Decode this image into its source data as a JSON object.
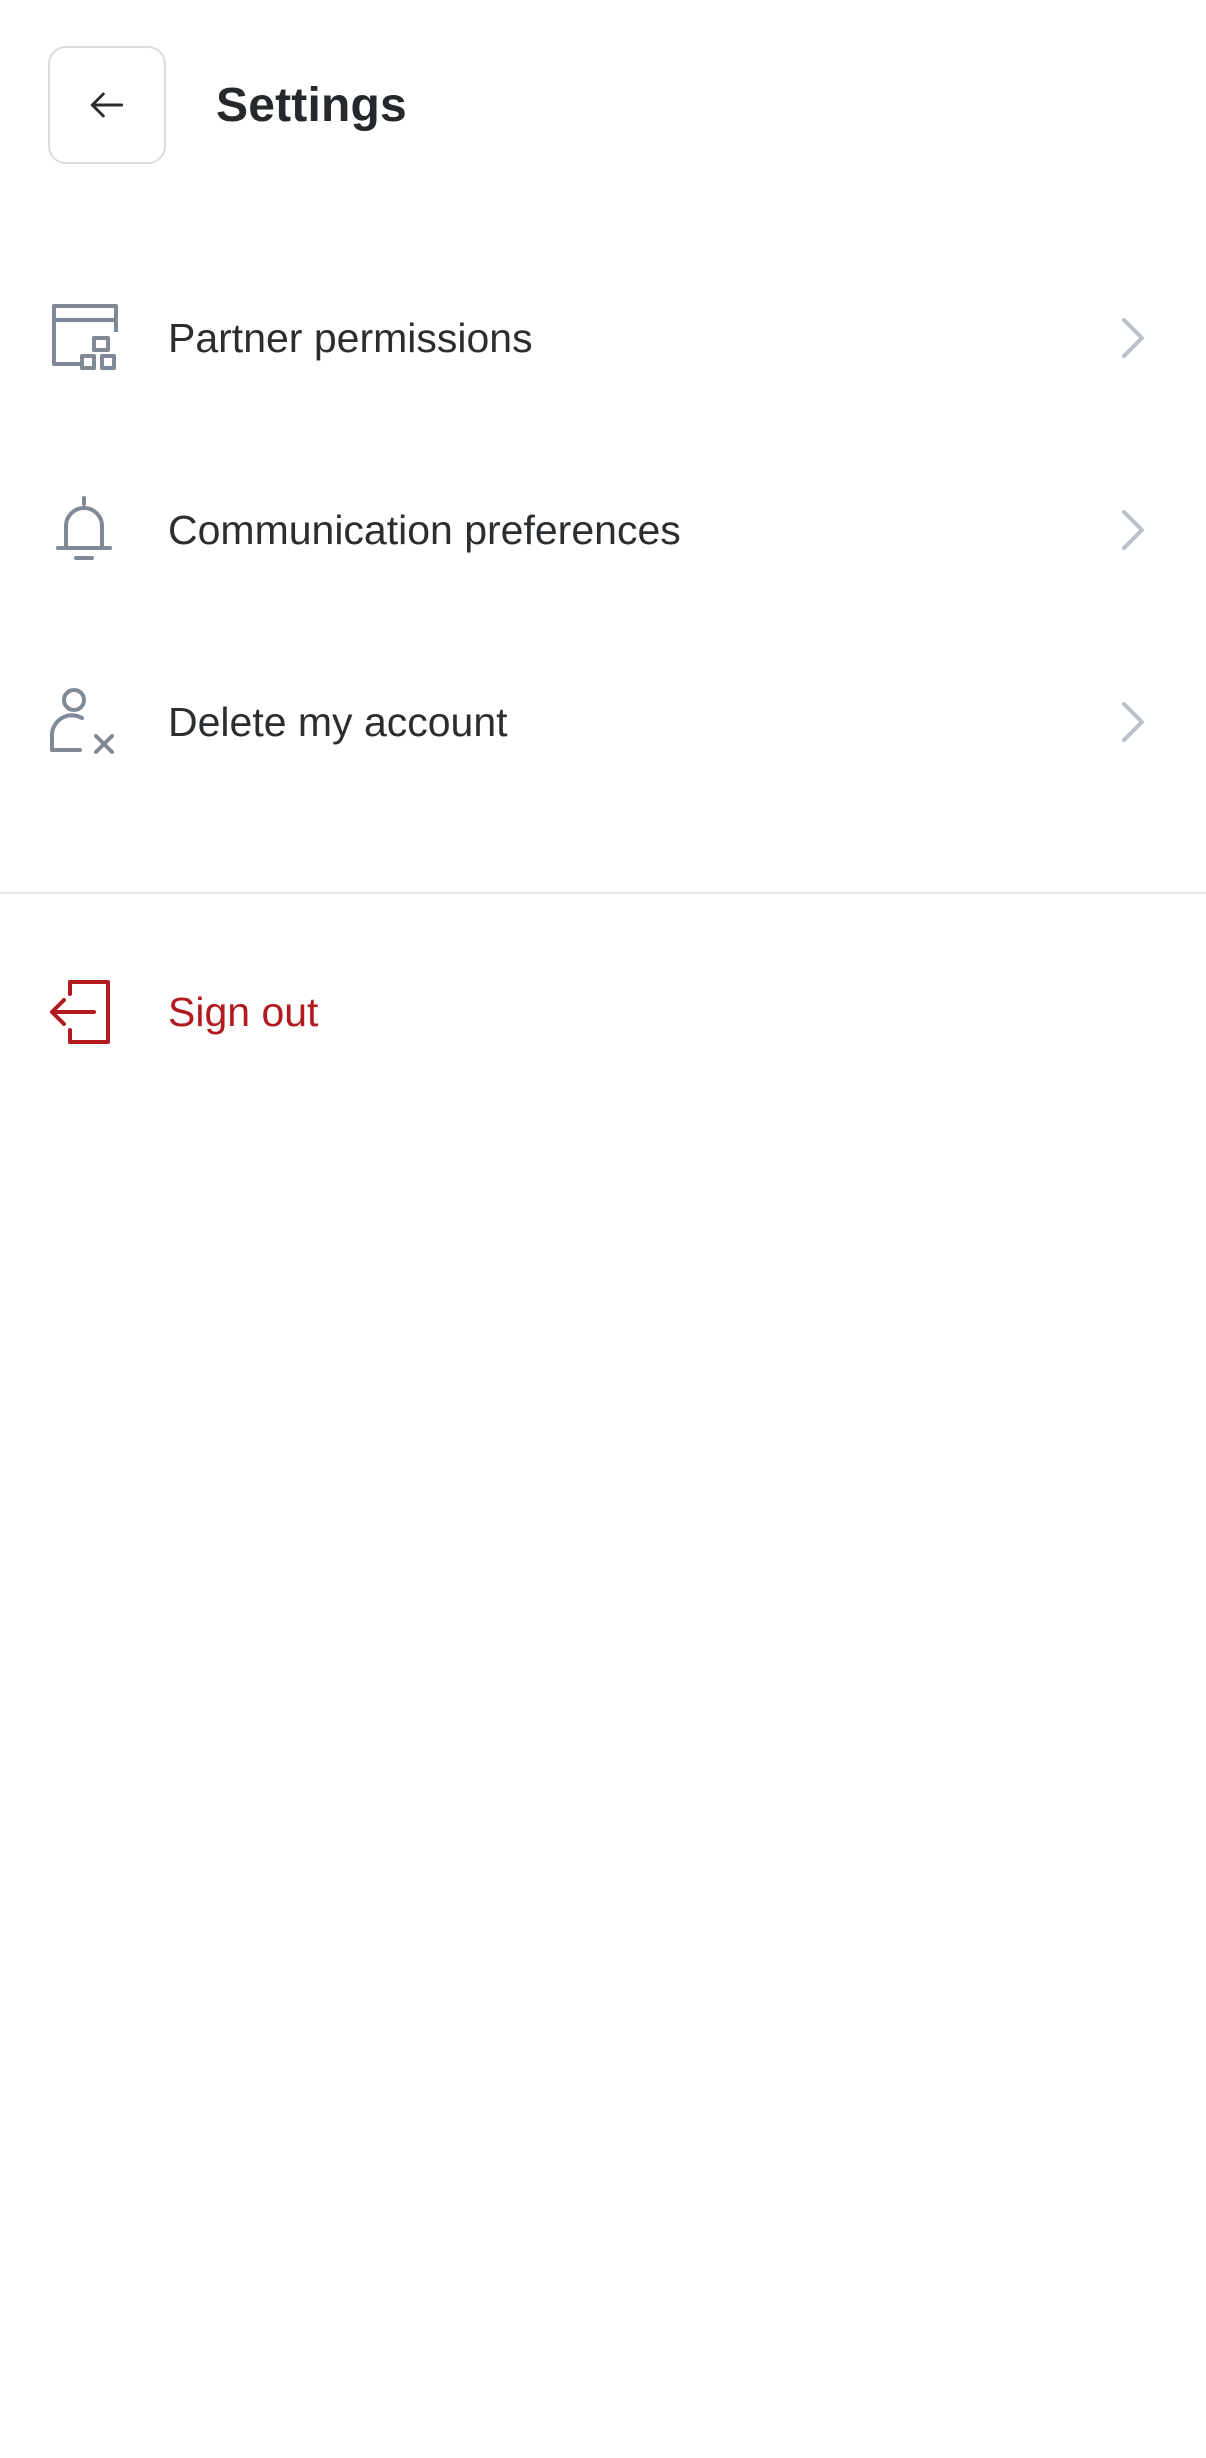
{
  "header": {
    "title": "Settings",
    "back_icon": "arrow-left-icon"
  },
  "menu": {
    "items": [
      {
        "label": "Partner permissions",
        "icon": "dashboard-layout-icon"
      },
      {
        "label": "Communication preferences",
        "icon": "bell-icon"
      },
      {
        "label": "Delete my account",
        "icon": "user-remove-icon"
      }
    ],
    "chevron_icon": "chevron-right-icon"
  },
  "signout": {
    "label": "Sign out",
    "icon": "sign-out-icon"
  },
  "colors": {
    "text": "#2b2e31",
    "icon": "#7f8a96",
    "chevron": "#b9c0c7",
    "danger": "#b3191f",
    "divider": "#e3e5e8",
    "border": "#d9dcdf"
  }
}
